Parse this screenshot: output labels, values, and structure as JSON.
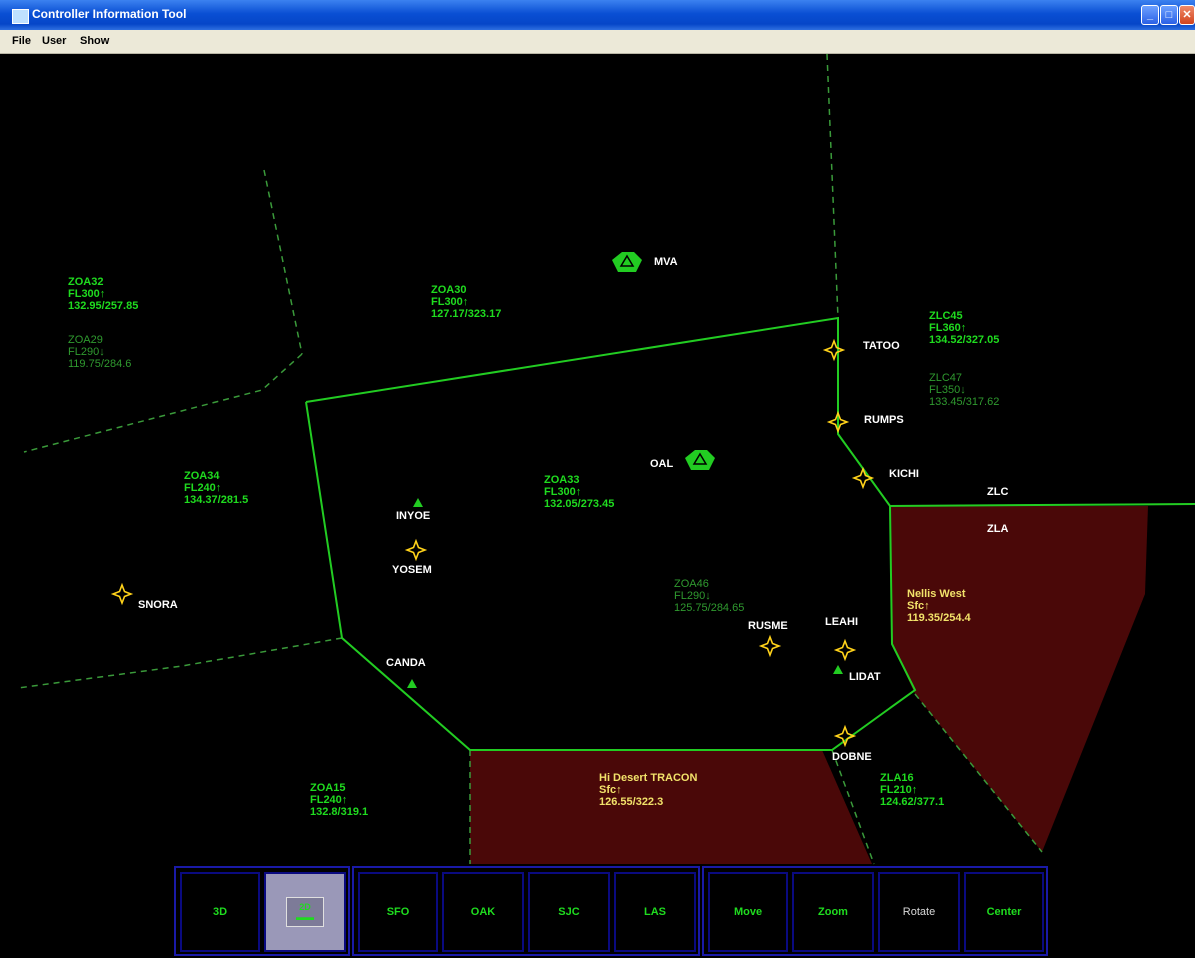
{
  "window": {
    "title": "Controller Information Tool"
  },
  "menu": [
    "File",
    "User",
    "Show"
  ],
  "colors": {
    "boundary": "#22cc22",
    "dashed": "#3a9a3a",
    "fix": "#ffd21a",
    "tracon": "#4a0808"
  },
  "sectors": [
    {
      "name": "ZOA32",
      "alt": "FL300↑",
      "freq": "132.95/257.85"
    },
    {
      "name": "ZOA29",
      "alt": "FL290↓",
      "freq": "119.75/284.6"
    },
    {
      "name": "ZOA30",
      "alt": "FL300↑",
      "freq": "127.17/323.17"
    },
    {
      "name": "ZLC45",
      "alt": "FL360↑",
      "freq": "134.52/327.05"
    },
    {
      "name": "ZLC47",
      "alt": "FL350↓",
      "freq": "133.45/317.62"
    },
    {
      "name": "ZOA34",
      "alt": "FL240↑",
      "freq": "134.37/281.5"
    },
    {
      "name": "ZOA33",
      "alt": "FL300↑",
      "freq": "132.05/273.45"
    },
    {
      "name": "ZOA46",
      "alt": "FL290↓",
      "freq": "125.75/284.65"
    },
    {
      "name": "Nellis West",
      "alt": "Sfc↑",
      "freq": "119.35/254.4"
    },
    {
      "name": "Hi Desert TRACON",
      "alt": "Sfc↑",
      "freq": "126.55/322.3"
    },
    {
      "name": "ZOA15",
      "alt": "FL240↑",
      "freq": "132.8/319.1"
    },
    {
      "name": "ZLA16",
      "alt": "FL210↑",
      "freq": "124.62/377.1"
    }
  ],
  "fixes": [
    "MVA",
    "OAL",
    "TATOO",
    "RUMPS",
    "KICHI",
    "ZLC",
    "ZLA",
    "INYOE",
    "YOSEM",
    "SNORA",
    "CANDA",
    "RUSME",
    "LEAHI",
    "LIDAT",
    "DOBNE"
  ],
  "toolbar": {
    "view_buttons": [
      "3D",
      "2D"
    ],
    "airport_buttons": [
      "SFO",
      "OAK",
      "SJC",
      "LAS"
    ],
    "tool_buttons": [
      "Move",
      "Zoom",
      "Rotate",
      "Center"
    ]
  }
}
